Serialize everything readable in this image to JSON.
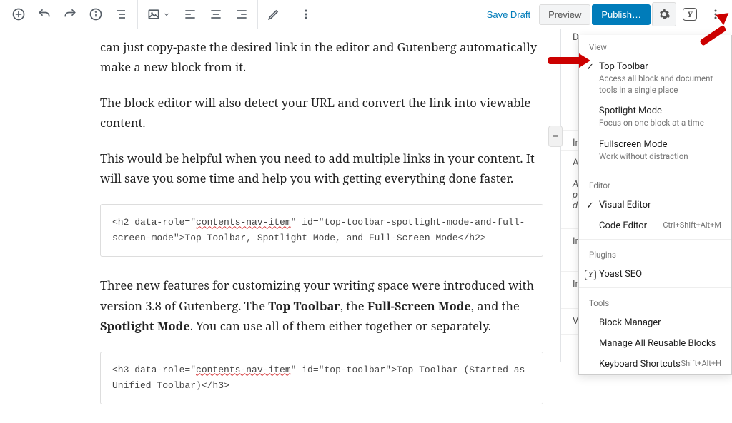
{
  "toolbar": {
    "save_draft": "Save Draft",
    "preview": "Preview",
    "publish": "Publish…"
  },
  "content": {
    "p1": "can just copy-paste the desired link in the editor and Gutenberg automatically make a new block from it.",
    "p2": "The block editor will also detect your URL and convert the link into viewable content.",
    "p3": "This would be helpful when you need to add multiple links in your content. It will save you some time and help you with getting everything done faster.",
    "code1_a": "<h2 data-role=\"",
    "code1_sq": "contents-nav-item",
    "code1_b": "\" id=\"top-toolbar-spotlight-mode-and-full-screen-mode\">Top Toolbar, Spotlight Mode, and Full-Screen Mode</h2>",
    "p4_a": "Three new features for customizing your writing space were introduced with version 3.8 of Gutenberg. The ",
    "p4_b1": "Top Toolbar",
    "p4_c": ", the ",
    "p4_b2": "Full-Screen Mode",
    "p4_d": ", and the ",
    "p4_b3": "Spotlight Mode",
    "p4_e": ". You can use all of them either together or separately.",
    "code2_a": "<h3 data-role=\"",
    "code2_sq": "contents-nav-item",
    "code2_b": "\" id=\"top-toolbar\">Top Toolbar (Started as Unified Toolbar)</h3>"
  },
  "sidebar": {
    "letters": [
      "D",
      "Ir",
      "A",
      "A",
      "p",
      "d",
      "Ir",
      "Ir",
      "V"
    ]
  },
  "menu": {
    "view": "View",
    "top_toolbar": "Top Toolbar",
    "top_toolbar_desc": "Access all block and document tools in a single place",
    "spotlight": "Spotlight Mode",
    "spotlight_desc": "Focus on one block at a time",
    "fullscreen": "Fullscreen Mode",
    "fullscreen_desc": "Work without distraction",
    "editor": "Editor",
    "visual": "Visual Editor",
    "code": "Code Editor",
    "code_shortcut": "Ctrl+Shift+Alt+M",
    "plugins": "Plugins",
    "yoast": "Yoast SEO",
    "tools": "Tools",
    "block_manager": "Block Manager",
    "reusable": "Manage All Reusable Blocks",
    "keyboard": "Keyboard Shortcuts",
    "keyboard_shortcut": "Shift+Alt+H"
  }
}
